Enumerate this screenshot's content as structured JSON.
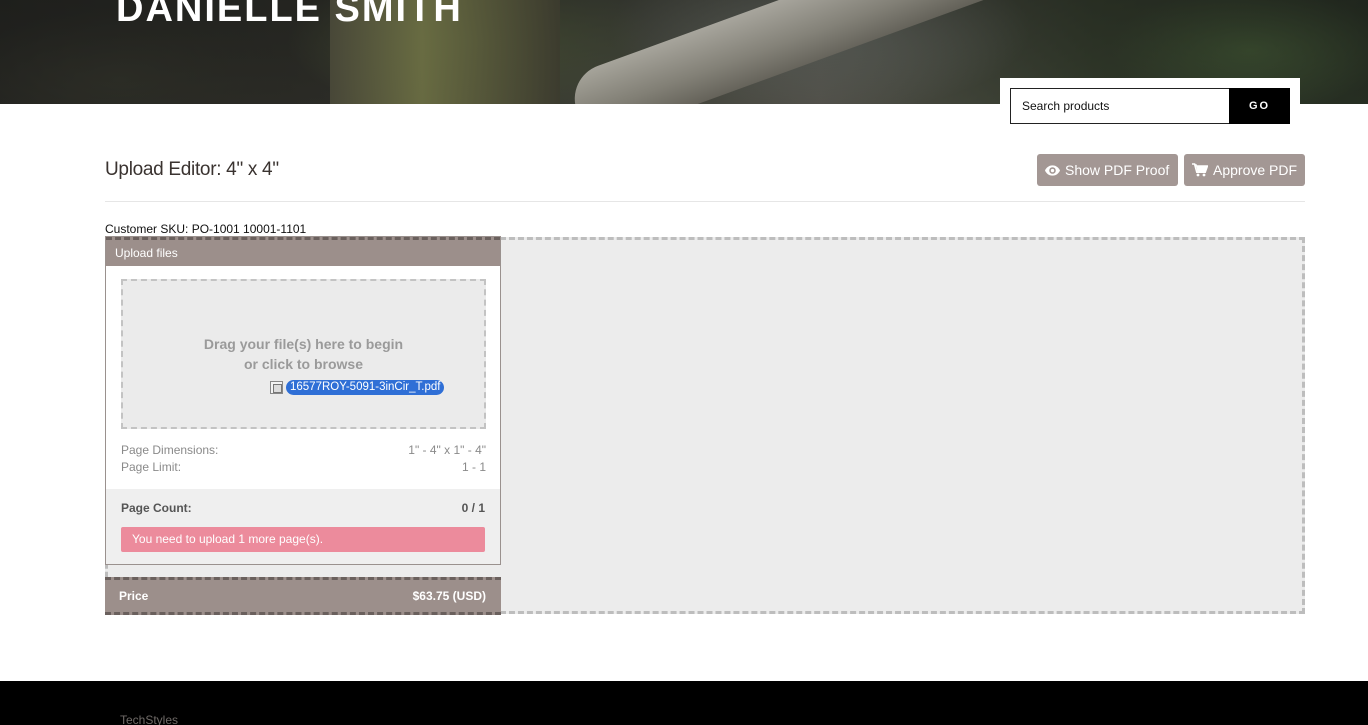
{
  "header": {
    "title": "DANIELLE SMITH",
    "search_placeholder": "Search products",
    "search_button": "GO"
  },
  "editor": {
    "title": "Upload Editor: 4\" x 4\"",
    "show_proof_label": "Show PDF Proof",
    "approve_label": "Approve PDF",
    "sku": "Customer SKU: PO-1001 10001-1101"
  },
  "upload": {
    "panel_title": "Upload files",
    "drop_line_1": "Drag your file(s) here to begin",
    "drop_line_2": "or click to browse",
    "dragging_file": "16577ROY-5091-3inCir_T.pdf",
    "page_dimensions_label": "Page Dimensions:",
    "page_dimensions_value": "1\" - 4\" x 1\" - 4\"",
    "page_limit_label": "Page Limit:",
    "page_limit_value": "1 - 1",
    "page_count_label": "Page Count:",
    "page_count_value": "0 / 1",
    "alert": "You need to upload 1 more page(s)."
  },
  "price": {
    "label": "Price",
    "value": "$63.75 (USD)"
  },
  "footer": {
    "brand": "TechStyles"
  }
}
